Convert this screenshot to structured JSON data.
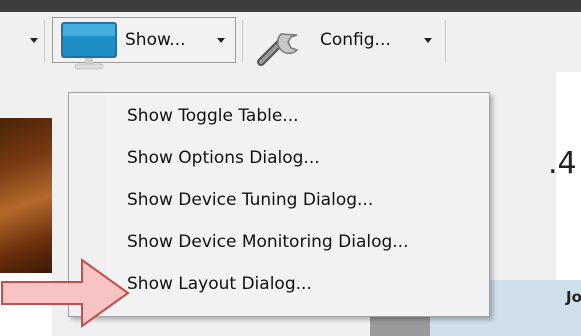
{
  "toolbar": {
    "show_label": "Show...",
    "config_label": "Config..."
  },
  "menu": {
    "items": [
      {
        "label": "Show Toggle Table..."
      },
      {
        "label": "Show Options Dialog..."
      },
      {
        "label": "Show Device Tuning Dialog..."
      },
      {
        "label": "Show Device Monitoring Dialog..."
      },
      {
        "label": "Show Layout Dialog..."
      }
    ]
  },
  "background": {
    "fragment_right": ".4",
    "fragment_bottom_right": "Jo"
  },
  "colors": {
    "arrow_fill": "#f7c3c3",
    "arrow_stroke": "#c0504d",
    "monitor_screen": "#1e8fc6"
  }
}
